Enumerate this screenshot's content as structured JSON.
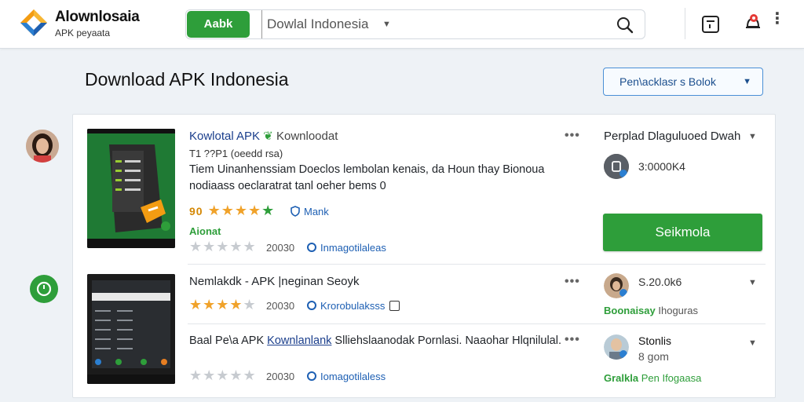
{
  "header": {
    "brand_title": "Alownlosaia",
    "brand_subtitle": "APK peyaata",
    "search_button": "Aabk",
    "search_value": "Dowlal Indonesia"
  },
  "page": {
    "title": "Download APK Indonesia",
    "sort_label": "Pen\\acklasr s Bolok"
  },
  "apps": [
    {
      "name": "Kowlotal APK",
      "name_suffix": "Kownloodat",
      "version": "T1 ??P1 (oeedd rsa)",
      "description": "Tiem Uinanhenssiam Doeclos lembolan kenais, da Houn thay Bionoua nodiaass oeclaratrat tanl oeher bems 0",
      "rating_prefix": "90",
      "tag": "Mank",
      "status": "Aionat",
      "downloads": "20030",
      "link": "Inmagotilaleas",
      "side_title": "Perplad Dlaguluoed Dwah",
      "side_value": "3:0000K4",
      "download_button": "Seikmola"
    },
    {
      "name": "Nemlakdk",
      "name_suffix": "- APK |neginan Seoyk",
      "downloads": "20030",
      "link": "Krorobulaksss",
      "side_value": "S.20.0k6",
      "side_green": "Boonaisay",
      "side_green_note": "Ihoguras"
    },
    {
      "name_prefix": "Baal Pe\\a APK",
      "name_link": "Kownlanlank",
      "name_rest": "Slliehslaanodak Pornlasi. Naaohar Hlqnilulal.",
      "downloads": "20030",
      "link": "Iomagotilaless",
      "side_title": "Stonlis",
      "side_value": "8 gom",
      "side_green": "Gralkla",
      "side_green_note": "Pen Ifogaasa"
    }
  ],
  "colors": {
    "accent_green": "#2e9e3a",
    "link_blue": "#1d5fb3",
    "star": "#f0a22a"
  }
}
